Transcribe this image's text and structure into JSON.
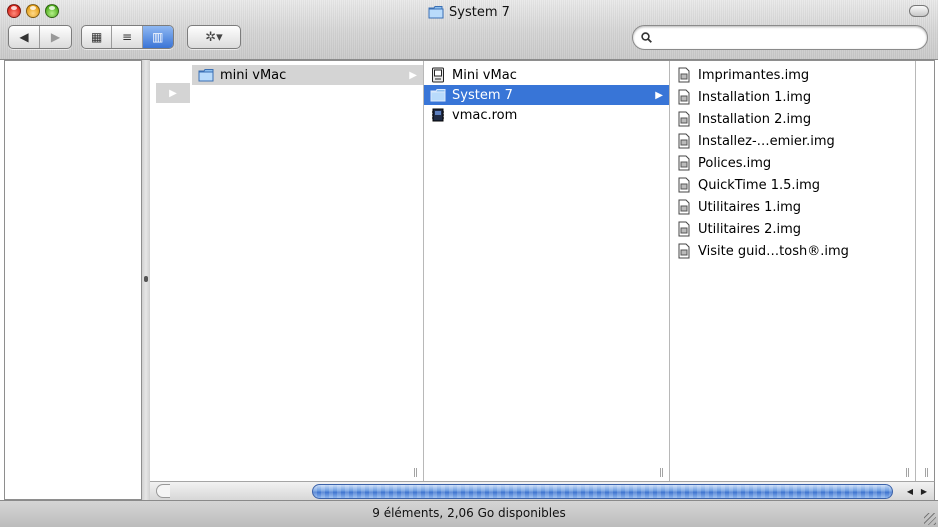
{
  "window": {
    "title": "System 7"
  },
  "toolbar": {
    "back_glyph": "◀",
    "forward_glyph": "▶",
    "view_icon_glyph": "▦",
    "view_list_glyph": "≡",
    "view_column_glyph": "▥",
    "action_glyph": "✲▾",
    "search_placeholder": "",
    "search_value": ""
  },
  "columns": [
    {
      "items": [
        {
          "label": "mini vMac",
          "icon": "folder-icon",
          "selected": "gray",
          "has_arrow": true
        }
      ]
    },
    {
      "items": [
        {
          "label": "Mini vMac",
          "icon": "application-icon",
          "selected": "",
          "has_arrow": false
        },
        {
          "label": "System 7",
          "icon": "folder-icon",
          "selected": "blue",
          "has_arrow": true
        },
        {
          "label": "vmac.rom",
          "icon": "rom-file-icon",
          "selected": "",
          "has_arrow": false
        }
      ]
    },
    {
      "items": [
        {
          "label": "Imprimantes.img",
          "icon": "disk-image-icon"
        },
        {
          "label": "Installation 1.img",
          "icon": "disk-image-icon"
        },
        {
          "label": "Installation 2.img",
          "icon": "disk-image-icon"
        },
        {
          "label": "Installez-…emier.img",
          "icon": "disk-image-icon"
        },
        {
          "label": "Polices.img",
          "icon": "disk-image-icon"
        },
        {
          "label": "QuickTime 1.5.img",
          "icon": "disk-image-icon"
        },
        {
          "label": "Utilitaires 1.img",
          "icon": "disk-image-icon"
        },
        {
          "label": "Utilitaires 2.img",
          "icon": "disk-image-icon"
        },
        {
          "label": "Visite guid…tosh®.img",
          "icon": "disk-image-icon"
        }
      ]
    }
  ],
  "status": {
    "text": "9 éléments, 2,06 Go disponibles"
  },
  "colors": {
    "selection_blue": "#3875d7",
    "selection_gray": "#d4d4d4"
  }
}
